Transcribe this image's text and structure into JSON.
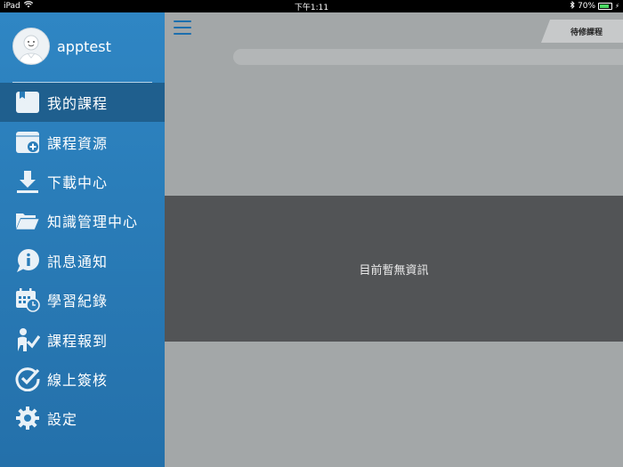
{
  "status_bar": {
    "device": "iPad",
    "time": "下午1:11",
    "battery": "70%"
  },
  "sidebar": {
    "username": "apptest",
    "items": [
      {
        "label": "我的課程",
        "icon": "book-icon",
        "active": true
      },
      {
        "label": "課程資源",
        "icon": "folder-add-icon",
        "active": false
      },
      {
        "label": "下載中心",
        "icon": "download-icon",
        "active": false
      },
      {
        "label": "知識管理中心",
        "icon": "open-folder-icon",
        "active": false
      },
      {
        "label": "訊息通知",
        "icon": "info-bubble-icon",
        "active": false
      },
      {
        "label": "學習紀錄",
        "icon": "calendar-clock-icon",
        "active": false
      },
      {
        "label": "課程報到",
        "icon": "check-in-person-icon",
        "active": false
      },
      {
        "label": "線上簽核",
        "icon": "check-circle-icon",
        "active": false
      },
      {
        "label": "設定",
        "icon": "gear-icon",
        "active": false
      }
    ]
  },
  "main": {
    "tab_label": "待修課程",
    "empty_message": "目前暫無資訊"
  },
  "colors": {
    "sidebar": "#2a7db9",
    "active_item": "#1f5f8e",
    "accent": "#1c6fae",
    "empty_panel": "#525456"
  }
}
